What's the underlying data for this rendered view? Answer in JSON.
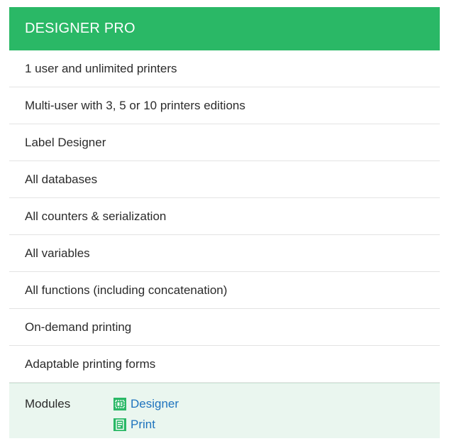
{
  "card": {
    "title": "DESIGNER PRO",
    "features": [
      "1 user and unlimited printers",
      "Multi-user with 3, 5 or 10 printers editions",
      "Label Designer",
      "All databases",
      "All counters & serialization",
      "All variables",
      "All functions (including concatenation)",
      "On-demand printing",
      "Adaptable printing forms"
    ],
    "modules": {
      "label": "Modules",
      "items": [
        {
          "name": "Designer",
          "icon": "designer-icon"
        },
        {
          "name": "Print",
          "icon": "print-icon"
        }
      ]
    }
  },
  "colors": {
    "header_bg": "#2ab866",
    "modules_bg": "#eaf6ef",
    "link": "#1e73be",
    "icon_green": "#2ab866"
  }
}
